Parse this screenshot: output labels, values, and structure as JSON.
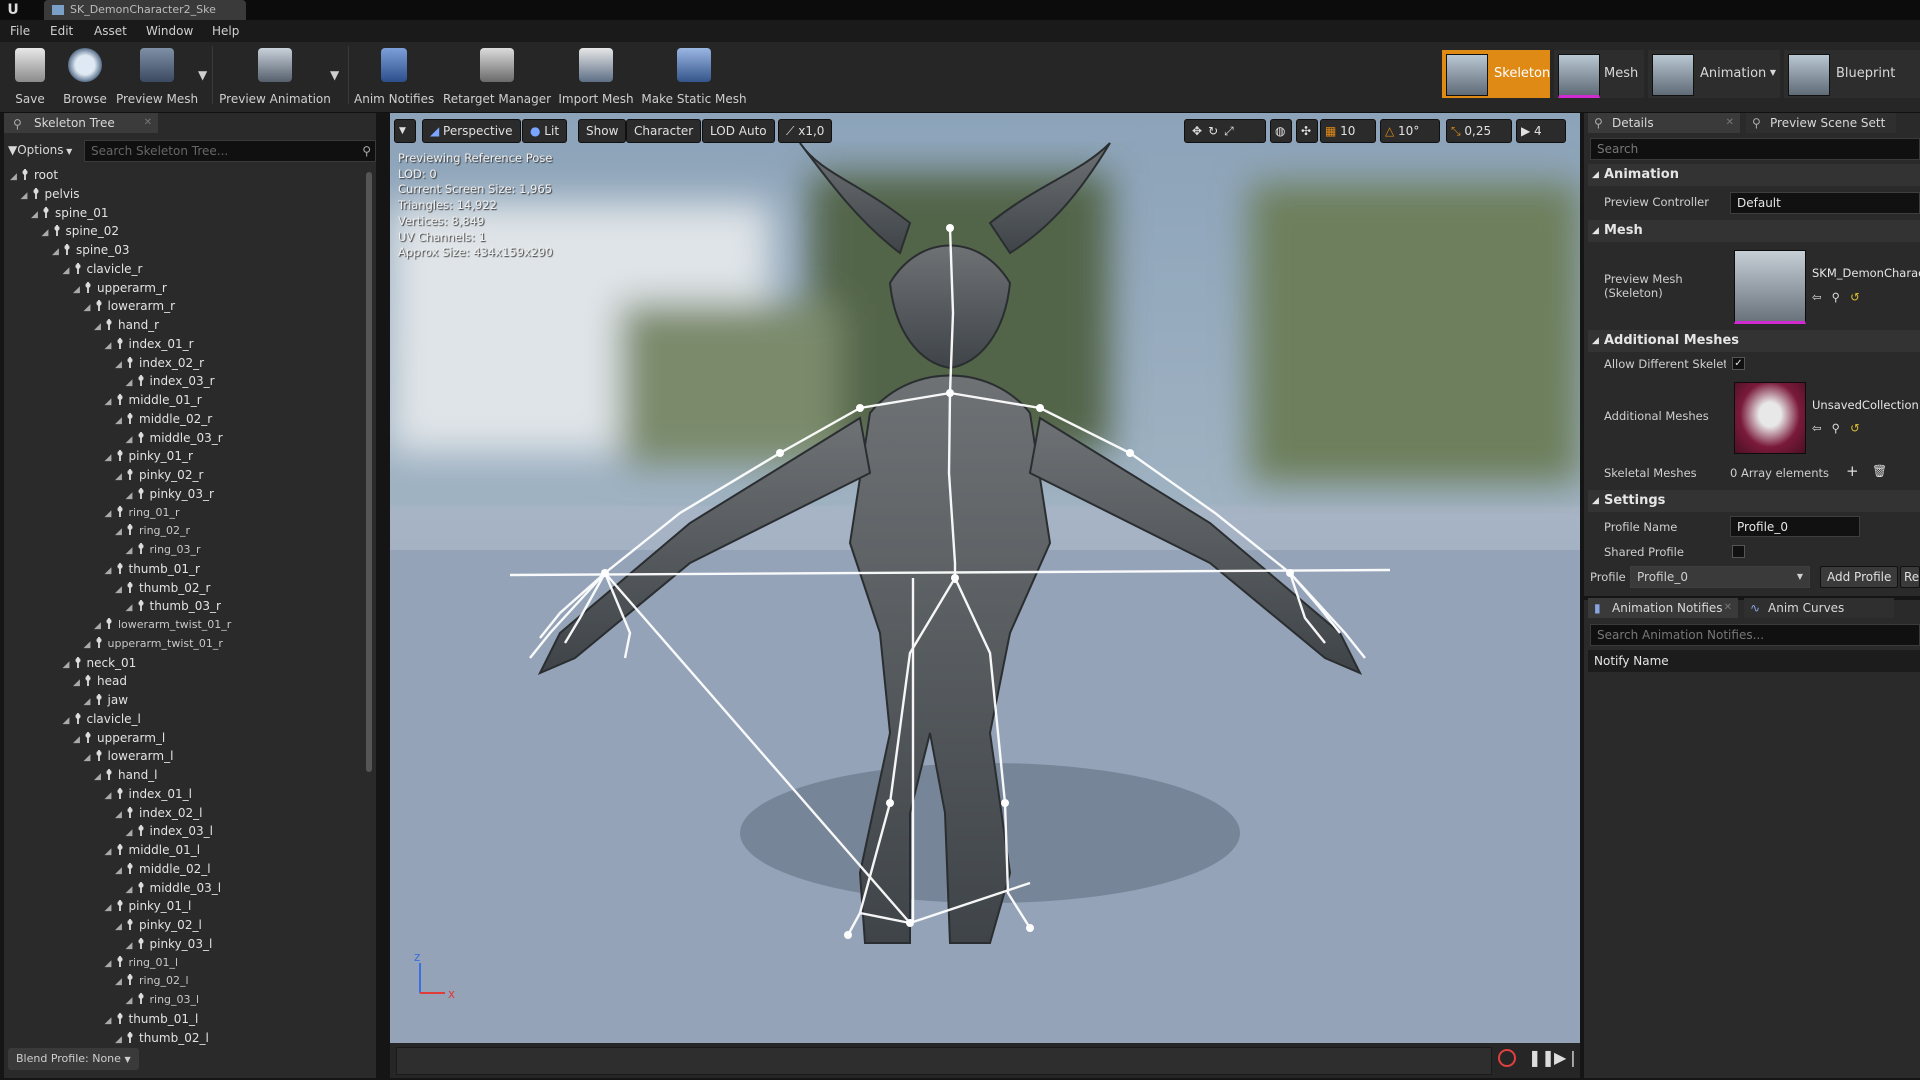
{
  "title_bar": {
    "document_tab": "SK_DemonCharacter2_Ske"
  },
  "menu": [
    "File",
    "Edit",
    "Asset",
    "Window",
    "Help"
  ],
  "toolbar": {
    "buttons": [
      "Save",
      "Browse",
      "Preview Mesh",
      "Preview Animation",
      "Anim Notifies",
      "Retarget Manager",
      "Import Mesh",
      "Make Static Mesh"
    ],
    "modes": [
      "Skeleton",
      "Mesh",
      "Animation",
      "Blueprint"
    ]
  },
  "skeleton_tree": {
    "tab": "Skeleton Tree",
    "options": "Options",
    "search_placeholder": "Search Skeleton Tree...",
    "bones": [
      {
        "name": "root",
        "depth": 0
      },
      {
        "name": "pelvis",
        "depth": 1
      },
      {
        "name": "spine_01",
        "depth": 2
      },
      {
        "name": "spine_02",
        "depth": 3
      },
      {
        "name": "spine_03",
        "depth": 4
      },
      {
        "name": "clavicle_r",
        "depth": 5
      },
      {
        "name": "upperarm_r",
        "depth": 6
      },
      {
        "name": "lowerarm_r",
        "depth": 7
      },
      {
        "name": "hand_r",
        "depth": 8
      },
      {
        "name": "index_01_r",
        "depth": 9
      },
      {
        "name": "index_02_r",
        "depth": 10
      },
      {
        "name": "index_03_r",
        "depth": 11
      },
      {
        "name": "middle_01_r",
        "depth": 9
      },
      {
        "name": "middle_02_r",
        "depth": 10
      },
      {
        "name": "middle_03_r",
        "depth": 11
      },
      {
        "name": "pinky_01_r",
        "depth": 9
      },
      {
        "name": "pinky_02_r",
        "depth": 10
      },
      {
        "name": "pinky_03_r",
        "depth": 11
      },
      {
        "name": "ring_01_r",
        "depth": 9,
        "dim": true
      },
      {
        "name": "ring_02_r",
        "depth": 10,
        "dim": true
      },
      {
        "name": "ring_03_r",
        "depth": 11,
        "dim": true
      },
      {
        "name": "thumb_01_r",
        "depth": 9
      },
      {
        "name": "thumb_02_r",
        "depth": 10
      },
      {
        "name": "thumb_03_r",
        "depth": 11
      },
      {
        "name": "lowerarm_twist_01_r",
        "depth": 8,
        "dim": true
      },
      {
        "name": "upperarm_twist_01_r",
        "depth": 7,
        "dim": true
      },
      {
        "name": "neck_01",
        "depth": 5
      },
      {
        "name": "head",
        "depth": 6
      },
      {
        "name": "jaw",
        "depth": 7
      },
      {
        "name": "clavicle_l",
        "depth": 5
      },
      {
        "name": "upperarm_l",
        "depth": 6
      },
      {
        "name": "lowerarm_l",
        "depth": 7
      },
      {
        "name": "hand_l",
        "depth": 8
      },
      {
        "name": "index_01_l",
        "depth": 9
      },
      {
        "name": "index_02_l",
        "depth": 10
      },
      {
        "name": "index_03_l",
        "depth": 11
      },
      {
        "name": "middle_01_l",
        "depth": 9
      },
      {
        "name": "middle_02_l",
        "depth": 10
      },
      {
        "name": "middle_03_l",
        "depth": 11
      },
      {
        "name": "pinky_01_l",
        "depth": 9
      },
      {
        "name": "pinky_02_l",
        "depth": 10
      },
      {
        "name": "pinky_03_l",
        "depth": 11
      },
      {
        "name": "ring_01_l",
        "depth": 9,
        "dim": true
      },
      {
        "name": "ring_02_l",
        "depth": 10,
        "dim": true
      },
      {
        "name": "ring_03_l",
        "depth": 11,
        "dim": true
      },
      {
        "name": "thumb_01_l",
        "depth": 9
      },
      {
        "name": "thumb_02_l",
        "depth": 10
      }
    ],
    "blend_profile": "Blend Profile: None"
  },
  "viewport": {
    "buttons": [
      "Perspective",
      "Lit",
      "Show",
      "Character",
      "LOD Auto",
      "x1,0"
    ],
    "snap": {
      "grid": "10",
      "rotation": "10°",
      "scale": "0,25",
      "camera_speed": "4"
    },
    "stats": [
      "Previewing Reference Pose",
      "LOD: 0",
      "Current Screen Size: 1,965",
      "Triangles: 14,922",
      "Vertices: 8,849",
      "UV Channels: 1",
      "Approx Size: 434x159x290"
    ],
    "axis_labels": {
      "z": "z",
      "x": "x"
    }
  },
  "details": {
    "tabs": [
      "Details",
      "Preview Scene Sett"
    ],
    "search_placeholder": "Search",
    "categories": {
      "animation": "Animation",
      "mesh": "Mesh",
      "additional_meshes": "Additional Meshes",
      "settings": "Settings"
    },
    "preview_controller_label": "Preview Controller",
    "preview_controller_value": "Default",
    "preview_mesh_label": "Preview Mesh (Skeleton)",
    "preview_mesh_value": "SKM_DemonCharact",
    "allow_different_label": "Allow Different Skeleto",
    "additional_meshes_label": "Additional Meshes",
    "additional_meshes_value": "UnsavedCollection",
    "skeletal_meshes_label": "Skeletal Meshes",
    "skeletal_meshes_value": "0 Array elements",
    "profile_name_label": "Profile Name",
    "profile_name_value": "Profile_0",
    "shared_profile_label": "Shared Profile",
    "profile_label": "Profile",
    "profile_value": "Profile_0",
    "add_profile": "Add Profile",
    "remove_profile": "Re"
  },
  "anim_notifies": {
    "tabs": [
      "Animation Notifies",
      "Anim Curves"
    ],
    "search_placeholder": "Search Animation Notifies...",
    "header": "Notify Name"
  }
}
